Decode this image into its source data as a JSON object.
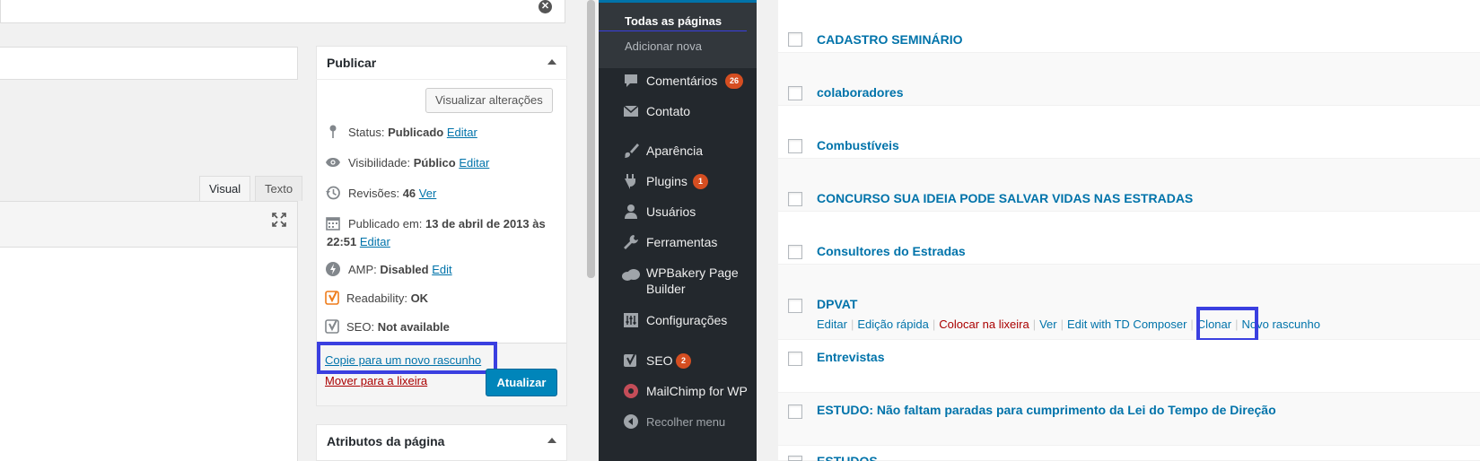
{
  "publish": {
    "title": "Publicar",
    "preview_label": "Visualizar alterações",
    "status_label": "Status:",
    "status_value": "Publicado",
    "visibility_label": "Visibilidade:",
    "visibility_value": "Público",
    "revisions_label": "Revisões:",
    "revisions_value": "46",
    "revisions_link": "Ver",
    "published_label": "Publicado em:",
    "published_value_line1": "13 de abril de 2013 às",
    "published_value_line2": "22:51",
    "amp_label": "AMP:",
    "amp_value": "Disabled",
    "amp_link": "Edit",
    "readability_label": "Readability:",
    "readability_value": "OK",
    "seo_label": "SEO:",
    "seo_value": "Not available",
    "edit_link": "Editar",
    "copy_draft": "Copie para um novo rascunho",
    "trash": "Mover para a lixeira",
    "update": "Atualizar"
  },
  "editor": {
    "tab_visual": "Visual",
    "tab_text": "Texto"
  },
  "attributes": {
    "title": "Atributos da página"
  },
  "sidebar": {
    "sub_active": "Todas as páginas",
    "sub_add": "Adicionar nova",
    "items": [
      {
        "label": "Comentários",
        "badge": "26",
        "icon": "comment-icon"
      },
      {
        "label": "Contato",
        "icon": "mail-icon"
      },
      {
        "label": "Aparência",
        "icon": "paintbrush-icon"
      },
      {
        "label": "Plugins",
        "badge": "1",
        "icon": "plugin-icon"
      },
      {
        "label": "Usuários",
        "icon": "user-icon"
      },
      {
        "label": "Ferramentas",
        "icon": "wrench-icon"
      },
      {
        "label": "WPBakery Page",
        "label2": "Builder",
        "icon": "cloud-icon"
      },
      {
        "label": "Configurações",
        "icon": "settings-icon"
      },
      {
        "label": "SEO",
        "badge": "2",
        "icon": "yoast-icon"
      },
      {
        "label": "MailChimp for WP",
        "icon": "mailchimp-icon"
      },
      {
        "label": "Recolher menu",
        "icon": "collapse-icon"
      }
    ]
  },
  "pages": {
    "rows": [
      "CADASTRO SEMINÁRIO",
      "colaboradores",
      "Combustíveis",
      "CONCURSO SUA IDEIA PODE SALVAR VIDAS NAS ESTRADAS",
      "Consultores do Estradas",
      "DPVAT",
      "Entrevistas",
      "ESTUDO: Não faltam paradas para cumprimento da Lei do Tempo de Direção",
      "ESTUDOS"
    ],
    "actions": {
      "edit": "Editar",
      "quick_edit": "Edição rápida",
      "trash": "Colocar na lixeira",
      "view": "Ver",
      "td": "Edit with TD Composer",
      "clone": "Clonar",
      "new_draft": "Novo rascunho"
    }
  },
  "colors": {
    "highlight": "#3a3fe0",
    "link": "#0073aa",
    "sidebar_bg": "#23282d",
    "badge": "#d54e21"
  }
}
